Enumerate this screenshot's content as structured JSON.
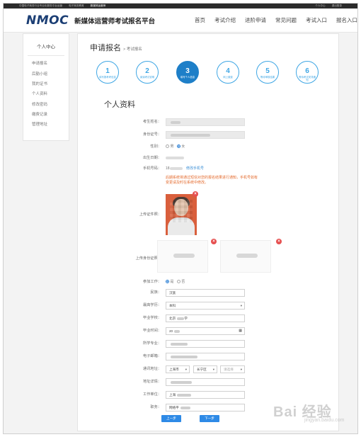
{
  "topbar": {
    "links": [
      "中国电子商务行业专业化服务平台运营",
      "电子商务教育",
      "新媒体运营师"
    ],
    "right": [
      "个人中心",
      "退出登录"
    ]
  },
  "header": {
    "logo": "NMOC",
    "title": "新媒体运营师考试报名平台",
    "nav": [
      "首页",
      "考试介绍",
      "进阶申请",
      "常见问题",
      "考试入口",
      "报名入口"
    ]
  },
  "sidebar": {
    "title": "个人中心",
    "items": [
      "申请报名",
      "后勤小组",
      "我的证书",
      "个人资料",
      "修改密码",
      "缴费记录",
      "管理地址"
    ]
  },
  "breadcrumb": {
    "main": "申请报名",
    "sub": "> 考试报名"
  },
  "steps": [
    {
      "num": "1",
      "label": "填写报考考信息",
      "active": false
    },
    {
      "num": "2",
      "label": "阅读考试说明",
      "active": false
    },
    {
      "num": "3",
      "label": "填写个人信息",
      "active": true
    },
    {
      "num": "4",
      "label": "网上缴费",
      "active": false
    },
    {
      "num": "5",
      "label": "等待审核结果",
      "active": false
    },
    {
      "num": "6",
      "label": "等待考试安排通知",
      "active": false
    }
  ],
  "section_title": "个人资料",
  "form": {
    "name_label": "考生姓名：",
    "id_label": "身份证号：",
    "gender_label": "性别：",
    "gender_opts": [
      "男",
      "女"
    ],
    "birth_label": "出生日期：",
    "phone_label": "手机号码：",
    "phone_value": "18",
    "phone_link": "修改手机号",
    "note": "后期系统将通过短信对您的报名结果进行通知，手机号如有变更请及时在系统中修改。",
    "photo_label": "上传证件照：",
    "idcard_label": "上传身份证照：",
    "job_label": "参加工作：",
    "job_opts": [
      "是",
      "否"
    ],
    "nation_label": "民族：",
    "nation_value": "汉族",
    "edu_label": "最高学历：",
    "edu_value": "本科",
    "school_label": "毕业学校：",
    "school_value": "北京",
    "school_suffix": "学",
    "gradtime_label": "毕业时间：",
    "gradtime_value": "20",
    "major_label": "所学专业：",
    "email_label": "电子邮箱：",
    "addr_label": "通讯地址：",
    "addr_province": "上海市",
    "addr_city": "长宁区",
    "addr_district": "请选择",
    "addr_detail_label": "地址详情：",
    "company_label": "工作单位：",
    "company_value": "上海",
    "position_label": "职务：",
    "position_value": "网络平"
  },
  "buttons": {
    "prev": "上一步",
    "next": "下一步"
  },
  "watermark": "Bai 经验",
  "watermark_sub": "jingyan.baidu.com"
}
